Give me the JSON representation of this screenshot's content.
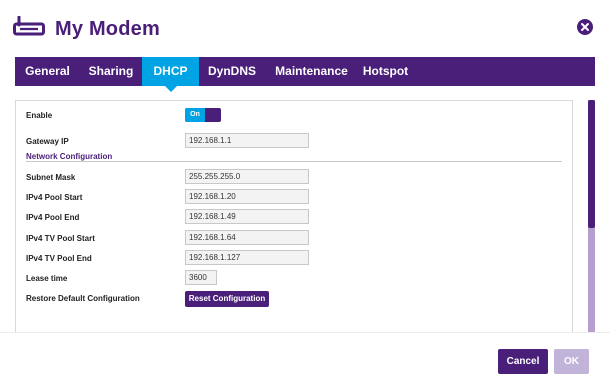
{
  "header": {
    "title": "My Modem",
    "icon": "modem-icon",
    "close_icon": "close-icon"
  },
  "tabs": [
    {
      "label": "General",
      "active": false
    },
    {
      "label": "Sharing",
      "active": false
    },
    {
      "label": "DHCP",
      "active": true
    },
    {
      "label": "DynDNS",
      "active": false
    },
    {
      "label": "Maintenance",
      "active": false
    },
    {
      "label": "Hotspot",
      "active": false
    }
  ],
  "form": {
    "enable_label": "Enable",
    "enable_toggle": "On",
    "gateway_label": "Gateway IP",
    "gateway_value": "192.168.1.1",
    "section_title": "Network Configuration",
    "subnet_label": "Subnet Mask",
    "subnet_value": "255.255.255.0",
    "pool_start_label": "IPv4 Pool Start",
    "pool_start_value": "192.168.1.20",
    "pool_end_label": "IPv4 Pool End",
    "pool_end_value": "192.168.1.49",
    "tv_start_label": "IPv4 TV Pool Start",
    "tv_start_value": "192.168.1.64",
    "tv_end_label": "IPv4 TV Pool End",
    "tv_end_value": "192.168.1.127",
    "lease_label": "Lease time",
    "lease_value": "3600",
    "restore_label": "Restore Default Configuration",
    "reset_button": "Reset Configuration"
  },
  "footer": {
    "cancel": "Cancel",
    "ok": "OK"
  },
  "colors": {
    "brand_purple": "#4a1f7a",
    "accent_blue": "#00a4e4",
    "disabled_purple": "#c2b3d9"
  }
}
